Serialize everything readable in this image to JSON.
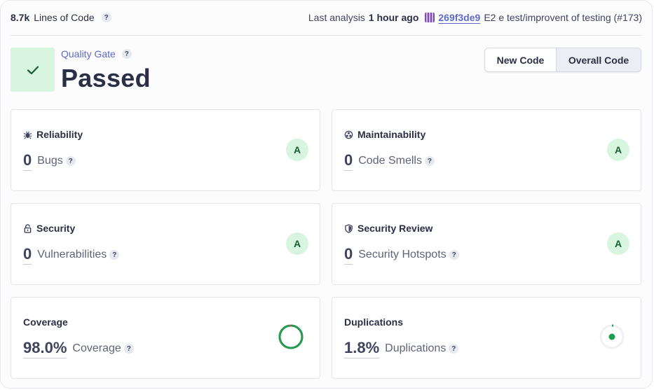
{
  "header": {
    "lines_of_code_value": "8.7k",
    "lines_of_code_label": "Lines of Code",
    "last_analysis_prefix": "Last analysis",
    "last_analysis_time": "1 hour ago",
    "commit_hash": "269f3de9",
    "commit_message": "E2 e test/improvent of testing (#173)"
  },
  "quality_gate": {
    "label": "Quality Gate",
    "status": "Passed",
    "status_icon": "check-icon",
    "color": "#d7f5df"
  },
  "toggle": {
    "options": [
      "New Code",
      "Overall Code"
    ],
    "selected": "Overall Code"
  },
  "cards": {
    "reliability": {
      "title": "Reliability",
      "icon": "bug-icon",
      "value": "0",
      "metric": "Bugs",
      "rating": "A"
    },
    "maintainability": {
      "title": "Maintainability",
      "icon": "smell-icon",
      "value": "0",
      "metric": "Code Smells",
      "rating": "A"
    },
    "security": {
      "title": "Security",
      "icon": "lock-icon",
      "value": "0",
      "metric": "Vulnerabilities",
      "rating": "A"
    },
    "security_review": {
      "title": "Security Review",
      "icon": "shield-icon",
      "value": "0",
      "metric": "Security Hotspots",
      "rating": "A"
    },
    "coverage": {
      "title": "Coverage",
      "value": "98.0%",
      "metric": "Coverage",
      "percent": 98.0
    },
    "duplications": {
      "title": "Duplications",
      "value": "1.8%",
      "metric": "Duplications",
      "percent": 1.8
    }
  },
  "help_glyph": "?",
  "colors": {
    "accent": "#5d6ac9",
    "pass_green": "#1f9e50",
    "rating_bg": "#d7f5df",
    "coverage_uncovered": "#d0494f"
  }
}
